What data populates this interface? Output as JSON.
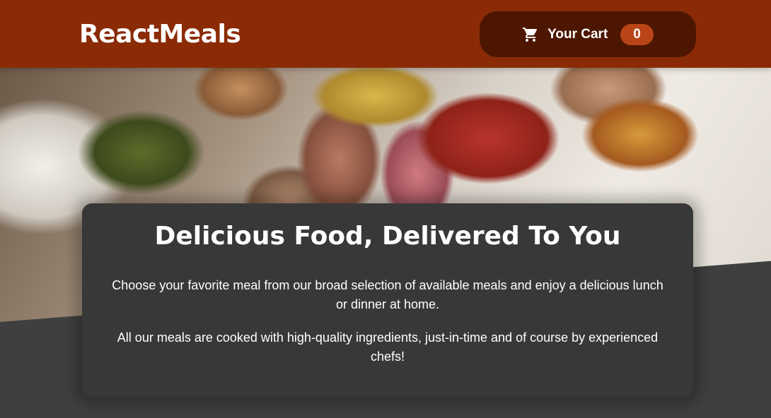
{
  "header": {
    "brand": "ReactMeals",
    "cart": {
      "label": "Your Cart",
      "count": "0",
      "icon": "cart-icon"
    }
  },
  "hero": {
    "image_alt": "A table full of delicious food!"
  },
  "summary": {
    "title": "Delicious Food, Delivered To You",
    "paragraph1": "Choose your favorite meal from our broad selection of available meals and enjoy a delicious lunch or dinner at home.",
    "paragraph2": "All our meals are cooked with high-quality ingredients, just-in-time and of course by experienced chefs!"
  },
  "colors": {
    "header_bg": "#8a2b06",
    "cart_button_bg": "#4d1601",
    "badge_bg": "#b94517",
    "page_bg": "#3f3f3f",
    "card_bg": "#383838"
  }
}
